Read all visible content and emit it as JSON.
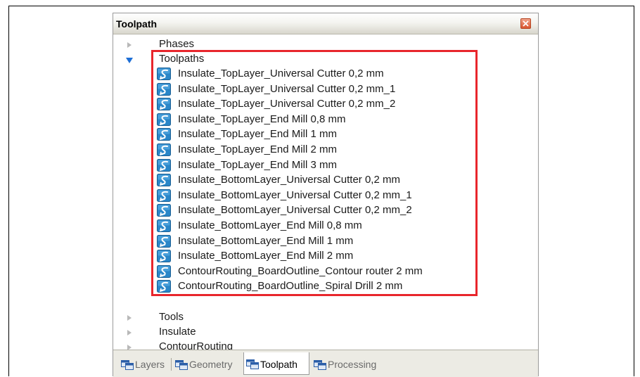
{
  "panel": {
    "title": "Toolpath",
    "close_icon": "close-icon"
  },
  "tree": {
    "phases_label": "Phases",
    "toolpaths_label": "Toolpaths",
    "toolpaths": [
      "Insulate_TopLayer_Universal Cutter 0,2 mm",
      "Insulate_TopLayer_Universal Cutter 0,2 mm_1",
      "Insulate_TopLayer_Universal Cutter 0,2 mm_2",
      "Insulate_TopLayer_End Mill 0,8 mm",
      "Insulate_TopLayer_End Mill 1 mm",
      "Insulate_TopLayer_End Mill 2 mm",
      "Insulate_TopLayer_End Mill 3 mm",
      "Insulate_BottomLayer_Universal Cutter 0,2 mm",
      "Insulate_BottomLayer_Universal Cutter 0,2 mm_1",
      "Insulate_BottomLayer_Universal Cutter 0,2 mm_2",
      "Insulate_BottomLayer_End Mill 0,8 mm",
      "Insulate_BottomLayer_End Mill 1 mm",
      "Insulate_BottomLayer_End Mill 2 mm",
      "ContourRouting_BoardOutline_Contour router 2 mm",
      "ContourRouting_BoardOutline_Spiral Drill   2 mm"
    ],
    "tools_label": "Tools",
    "insulate_label": "Insulate",
    "contourrouting_label": "ContourRouting"
  },
  "tabs": [
    {
      "label": "Layers",
      "active": false
    },
    {
      "label": "Geometry",
      "active": false
    },
    {
      "label": "Toolpath",
      "active": true
    },
    {
      "label": "Processing",
      "active": false
    }
  ],
  "colors": {
    "highlight": "#e8262c",
    "expander_open": "#1e6fd6",
    "expander_closed": "#b8b8b8",
    "toolpath_icon": "#2a86c8"
  }
}
